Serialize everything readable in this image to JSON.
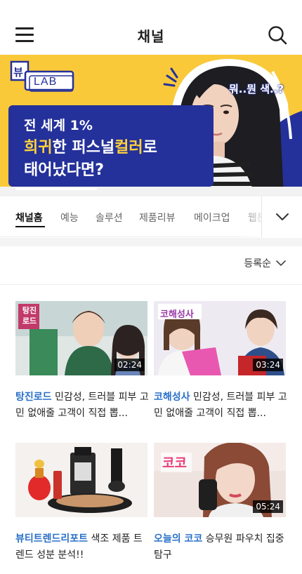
{
  "header": {
    "title": "채널",
    "menu_icon": "hamburger-menu-icon",
    "search_icon": "search-icon"
  },
  "banner": {
    "logo_top": "뷰",
    "logo_bottom": "LAB",
    "line1": "전 세계 1%",
    "line2_highlight1": "희귀",
    "line2_mid": "한 퍼스널",
    "line2_highlight2": "컬러",
    "line2_end": "로",
    "line3": "태어났다면?",
    "speech": "뭐..뭔 색..?",
    "progress": 0.3,
    "colors": {
      "background": "#f9c93a",
      "panel": "#24319a",
      "highlight": "#ffd23a"
    }
  },
  "tabs": {
    "items": [
      "채널홈",
      "예능",
      "솔루션",
      "제품리뷰",
      "메이크업",
      "웹툰"
    ],
    "active_index": 0,
    "more_icon": "chevron-down-icon"
  },
  "sort": {
    "label": "등록순",
    "icon": "chevron-down-icon"
  },
  "videos": [
    {
      "prefix": "탕진로드",
      "title": " 민감성, 트러블 피부 고민 없애줄 고객이 직접 뽑...",
      "duration": "02:24",
      "badge": "탕진 로드"
    },
    {
      "prefix": "코해성사",
      "title": " 민감성, 트러블 피부 고민 없애줄 고객이 직접 뽑...",
      "duration": "03:24",
      "badge": "코해성사"
    },
    {
      "prefix": "뷰티트렌드리포트",
      "title": " 색조 제품 트렌드 성분 분석!!",
      "duration": "",
      "badge": ""
    },
    {
      "prefix": "오늘의 코코",
      "title": " 승무원 파우치 집중탐구",
      "duration": "05:24",
      "badge": "코코"
    }
  ],
  "accent_color": "#2a70c9"
}
